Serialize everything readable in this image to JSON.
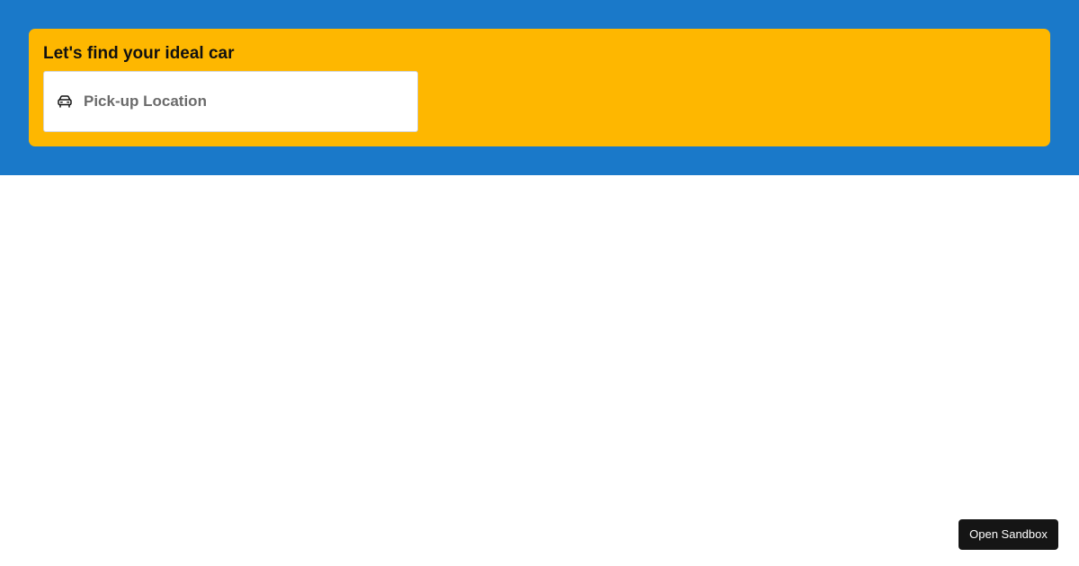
{
  "search": {
    "title": "Let's find your ideal car",
    "pickup_placeholder": "Pick-up Location",
    "pickup_value": "",
    "pickup_icon": "car-icon"
  },
  "footer": {
    "sandbox_label": "Open Sandbox"
  },
  "colors": {
    "hero_background": "#1a79c9",
    "search_card": "#feb700",
    "sandbox_button": "#151515"
  }
}
